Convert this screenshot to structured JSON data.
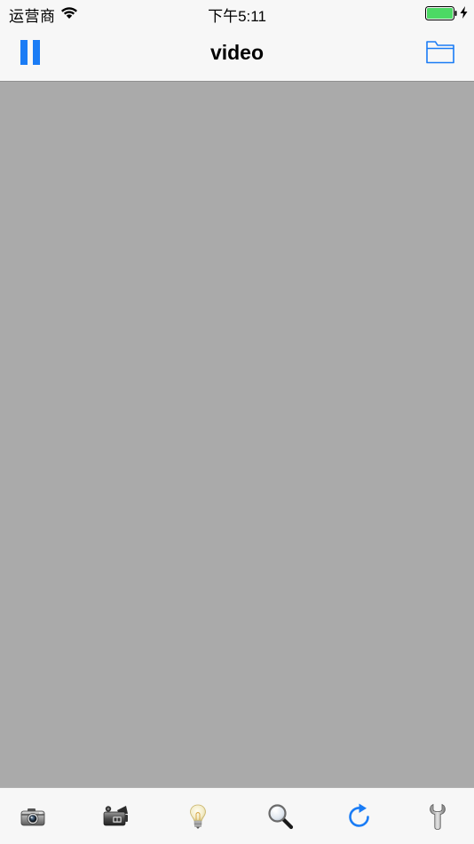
{
  "status_bar": {
    "carrier": "运营商",
    "time": "下午5:11",
    "wifi_icon": "wifi-icon",
    "battery_icon": "battery-icon",
    "charging_icon": "charging-bolt-icon",
    "battery_color": "#4cd964"
  },
  "nav_bar": {
    "title": "video",
    "left_button_icon": "pause-icon",
    "right_button_icon": "folder-icon",
    "tint_color": "#1a7cf5"
  },
  "content": {
    "background_color": "#aaaaaa"
  },
  "toolbar": {
    "items": [
      {
        "icon": "camera-icon"
      },
      {
        "icon": "video-camera-icon"
      },
      {
        "icon": "lightbulb-icon"
      },
      {
        "icon": "magnifier-icon"
      },
      {
        "icon": "refresh-icon"
      },
      {
        "icon": "wrench-icon"
      }
    ]
  }
}
